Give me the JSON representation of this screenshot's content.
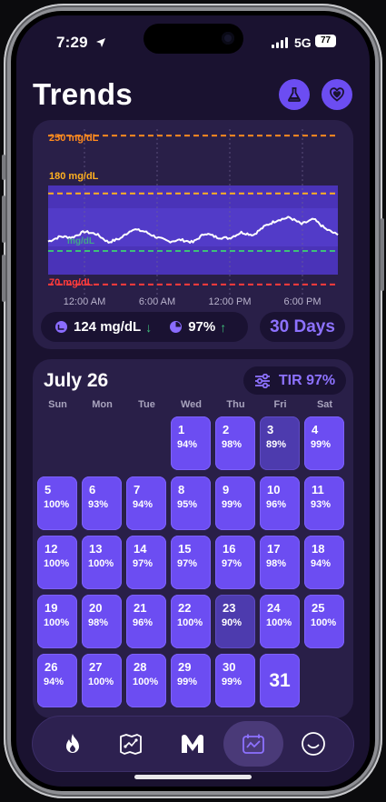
{
  "status": {
    "time": "7:29",
    "network": "5G",
    "battery": "77"
  },
  "header": {
    "title": "Trends"
  },
  "chart": {
    "thresholds": [
      {
        "label": "250 mg/dL",
        "color": "#ff8a1f"
      },
      {
        "label": "180 mg/dL",
        "color": "#ffb020"
      },
      {
        "label": "70 mg/dL",
        "color": "#ff3b3b"
      }
    ],
    "target_label": "mg/dL",
    "x_ticks": [
      "12:00 AM",
      "6:00 AM",
      "12:00 PM",
      "6:00 PM"
    ]
  },
  "chart_data": {
    "type": "line",
    "xlabel": "",
    "ylabel": "",
    "x_ticks": [
      "12:00 AM",
      "6:00 AM",
      "12:00 PM",
      "6:00 PM"
    ],
    "ylim": [
      60,
      260
    ],
    "reference_lines": [
      {
        "value": 250,
        "label": "250 mg/dL",
        "color": "#ff8a1f"
      },
      {
        "value": 180,
        "label": "180 mg/dL",
        "color": "#ffb020"
      },
      {
        "value": 70,
        "label": "70 mg/dL",
        "color": "#ff3b3b"
      }
    ],
    "series": [
      {
        "x": [
          0,
          1,
          2,
          3,
          4,
          5,
          6,
          7,
          8,
          9,
          10,
          11,
          12,
          13,
          14,
          15,
          16,
          17,
          18,
          19,
          20,
          21,
          22,
          23,
          24
        ],
        "values": [
          122,
          128,
          127,
          134,
          131,
          121,
          126,
          137,
          134,
          127,
          122,
          124,
          121,
          132,
          127,
          126,
          133,
          130,
          141,
          148,
          151,
          143,
          149,
          137,
          130
        ]
      }
    ]
  },
  "stats": {
    "avg": "124 mg/dL",
    "tir": "97%",
    "period": "30 Days"
  },
  "calendar": {
    "month": "July 26",
    "tir_label": "TIR 97%",
    "weekdays": [
      "Sun",
      "Mon",
      "Tue",
      "Wed",
      "Thu",
      "Fri",
      "Sat"
    ],
    "days": [
      {
        "n": "1",
        "p": "94%"
      },
      {
        "n": "2",
        "p": "98%"
      },
      {
        "n": "3",
        "p": "89%"
      },
      {
        "n": "4",
        "p": "99%"
      },
      {
        "n": "5",
        "p": "100%"
      },
      {
        "n": "6",
        "p": "93%"
      },
      {
        "n": "7",
        "p": "94%"
      },
      {
        "n": "8",
        "p": "95%"
      },
      {
        "n": "9",
        "p": "99%"
      },
      {
        "n": "10",
        "p": "96%"
      },
      {
        "n": "11",
        "p": "93%"
      },
      {
        "n": "12",
        "p": "100%"
      },
      {
        "n": "13",
        "p": "100%"
      },
      {
        "n": "14",
        "p": "97%"
      },
      {
        "n": "15",
        "p": "97%"
      },
      {
        "n": "16",
        "p": "97%"
      },
      {
        "n": "17",
        "p": "98%"
      },
      {
        "n": "18",
        "p": "94%"
      },
      {
        "n": "19",
        "p": "100%"
      },
      {
        "n": "20",
        "p": "98%"
      },
      {
        "n": "21",
        "p": "96%"
      },
      {
        "n": "22",
        "p": "100%"
      },
      {
        "n": "23",
        "p": "90%"
      },
      {
        "n": "24",
        "p": "100%"
      },
      {
        "n": "25",
        "p": "100%"
      },
      {
        "n": "26",
        "p": "94%"
      },
      {
        "n": "27",
        "p": "100%"
      },
      {
        "n": "28",
        "p": "100%"
      },
      {
        "n": "29",
        "p": "99%"
      },
      {
        "n": "30",
        "p": "99%"
      },
      {
        "n": "31",
        "p": ""
      }
    ]
  },
  "tabs": [
    {
      "icon": "flame-icon"
    },
    {
      "icon": "map-icon"
    },
    {
      "icon": "logo-m-icon"
    },
    {
      "icon": "trends-calendar-icon"
    },
    {
      "icon": "smiley-icon"
    }
  ],
  "colors": {
    "accent": "#6c4df2",
    "background": "#1a1230",
    "card": "#291f48"
  }
}
